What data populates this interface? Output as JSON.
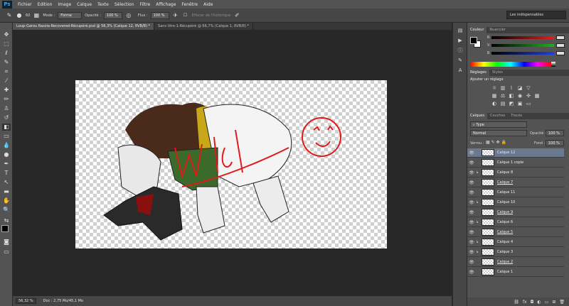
{
  "menubar": {
    "logo": "Ps",
    "items": [
      "Fichier",
      "Edition",
      "Image",
      "Calque",
      "Texte",
      "Sélection",
      "Filtre",
      "Affichage",
      "Fenêtre",
      "Aide"
    ]
  },
  "options": {
    "size": "60",
    "mode_label": "Mode :",
    "mode_value": "Forme",
    "opacity_label": "Opacité :",
    "opacity_value": "100 %",
    "flux_label": "Flux :",
    "flux_value": "100 %",
    "history_label": "Effacer de l'historique"
  },
  "workspace": "Les indispensables",
  "tabs": [
    "Loup-Garou Razzia-Recovered-Récupéré.psd @ 56,3% (Calque 12, RVB/8) *",
    "Sans titre-1-Récupéré @ 66,7% (Calque 1, RVB/8) *"
  ],
  "status": {
    "zoom": "56,32 %",
    "doc": "Doc : 2,75 Mo/45,1 Mo"
  },
  "color_panel": {
    "tabs": [
      "Couleur",
      "Nuancier"
    ],
    "channels": [
      "R",
      "V",
      "B"
    ],
    "colors": {
      "fg": "#000000",
      "bg": "#ffffff",
      "red": "#e02020",
      "green": "#20b020",
      "blue": "#2040e0"
    }
  },
  "adjust_panel": {
    "tabs": [
      "Réglages",
      "Styles"
    ],
    "title": "Ajouter un réglage"
  },
  "layers_panel": {
    "tabs": [
      "Calques",
      "Couches",
      "Tracés"
    ],
    "filter": "Type",
    "blend": "Normal",
    "opacity_label": "Opacité :",
    "opacity_value": "100 %",
    "lock_label": "Verrou :",
    "fill_label": "Fond :",
    "fill_value": "100 %",
    "layers": [
      {
        "name": "Calque 12",
        "selected": true,
        "clip": false,
        "underline": false
      },
      {
        "name": "Calque 1 copie",
        "selected": false,
        "clip": false,
        "underline": false
      },
      {
        "name": "Calque 8",
        "selected": false,
        "clip": true,
        "underline": false
      },
      {
        "name": "Calque 7",
        "selected": false,
        "clip": false,
        "underline": true
      },
      {
        "name": "Calque 11",
        "selected": false,
        "clip": false,
        "underline": false
      },
      {
        "name": "Calque 10",
        "selected": false,
        "clip": true,
        "underline": false
      },
      {
        "name": "Calque 9",
        "selected": false,
        "clip": false,
        "underline": true
      },
      {
        "name": "Calque 6",
        "selected": false,
        "clip": true,
        "underline": false
      },
      {
        "name": "Calque 5",
        "selected": false,
        "clip": false,
        "underline": true
      },
      {
        "name": "Calque 4",
        "selected": false,
        "clip": true,
        "underline": false
      },
      {
        "name": "Calque 3",
        "selected": false,
        "clip": true,
        "underline": false
      },
      {
        "name": "Calque 2",
        "selected": false,
        "clip": false,
        "underline": true
      },
      {
        "name": "Calque 1",
        "selected": false,
        "clip": false,
        "underline": false
      }
    ]
  }
}
